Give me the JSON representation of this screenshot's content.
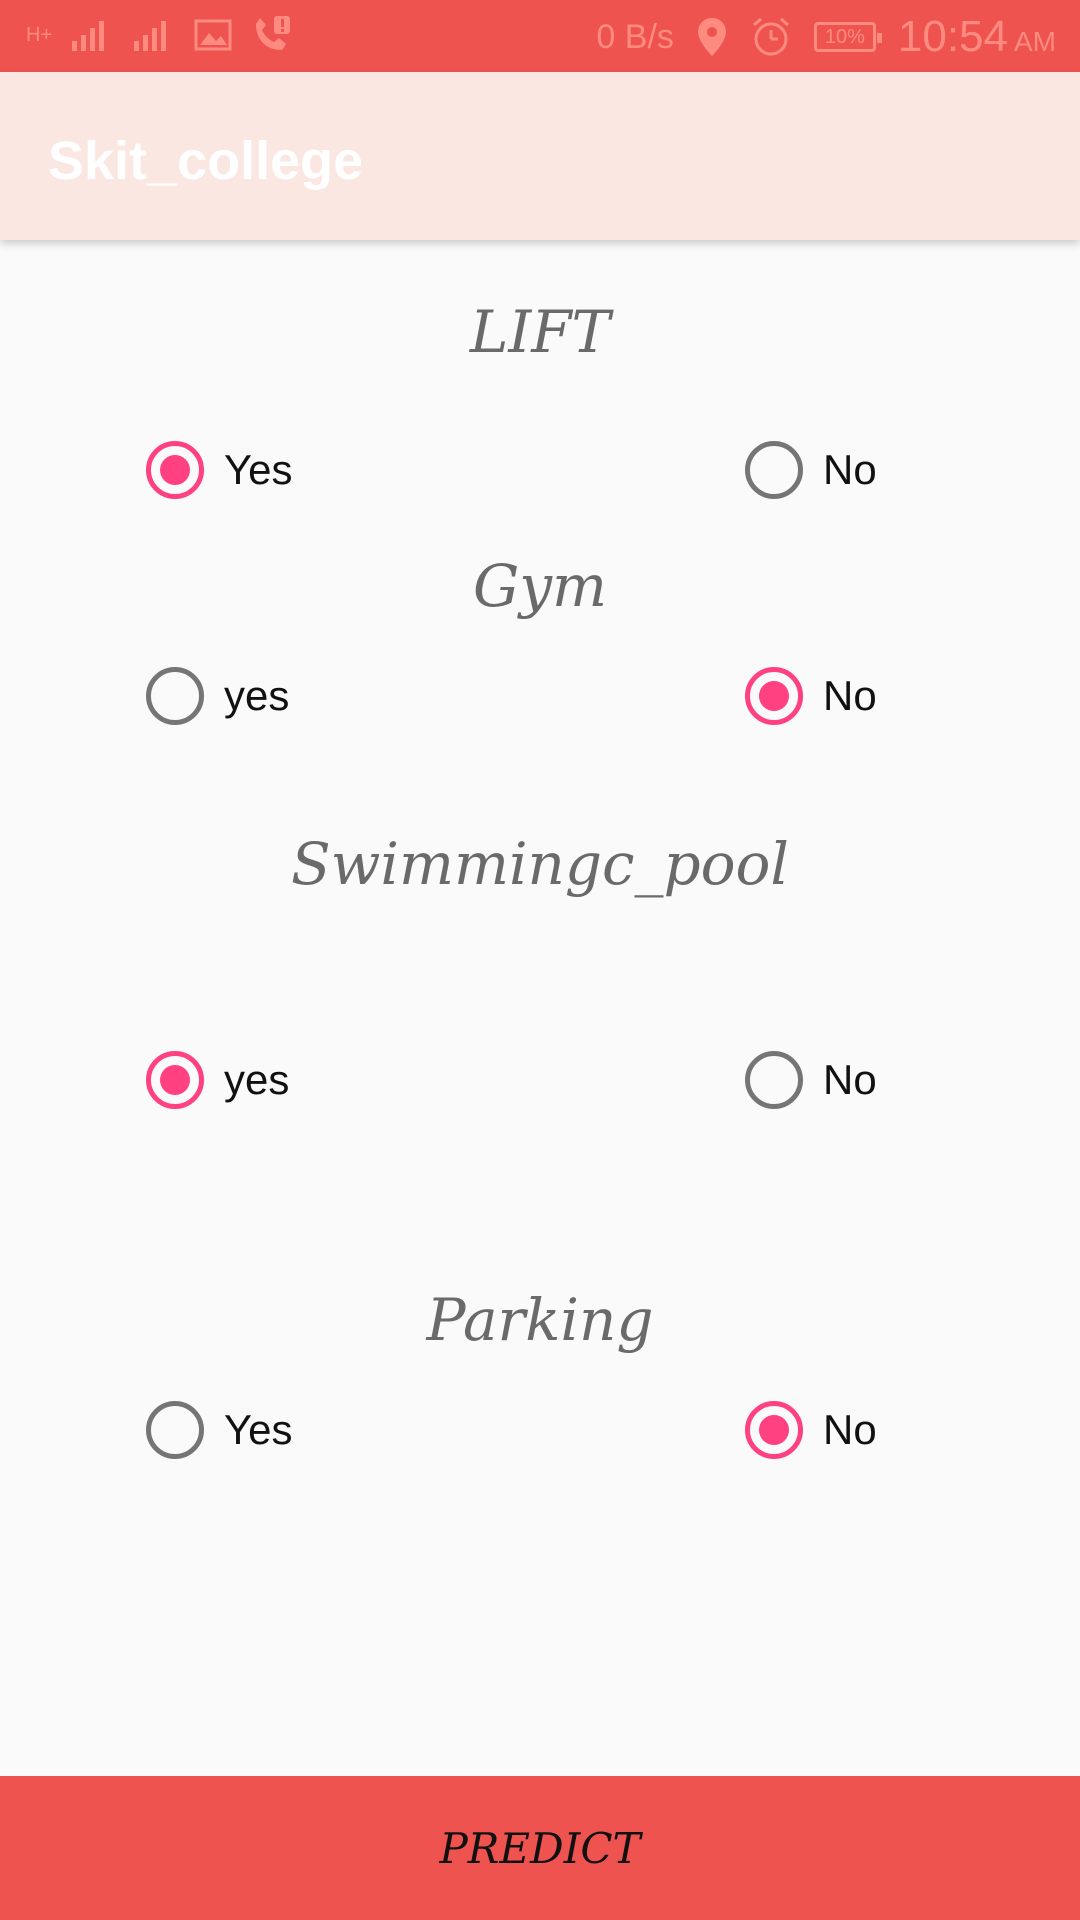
{
  "status_bar": {
    "network_label": "H+",
    "data_speed": "0 B/s",
    "battery": "10%",
    "time": "10:54",
    "ampm": "AM"
  },
  "app_bar": {
    "title": "Skit_college"
  },
  "sections": [
    {
      "title": "LIFT",
      "options": [
        {
          "label": "Yes",
          "checked": true
        },
        {
          "label": "No",
          "checked": false
        }
      ]
    },
    {
      "title": "Gym",
      "options": [
        {
          "label": "yes",
          "checked": false
        },
        {
          "label": "No",
          "checked": true
        }
      ]
    },
    {
      "title": "Swimmingc_pool",
      "options": [
        {
          "label": "yes",
          "checked": true
        },
        {
          "label": "No",
          "checked": false
        }
      ]
    },
    {
      "title": "Parking",
      "options": [
        {
          "label": "Yes",
          "checked": false
        },
        {
          "label": "No",
          "checked": true
        }
      ]
    }
  ],
  "predict_button": {
    "label": "PREDICT"
  },
  "colors": {
    "status_bar": "#ef5350",
    "app_bar": "#fbe7e1",
    "accent": "#ff4081",
    "radio_unchecked": "#757575"
  }
}
